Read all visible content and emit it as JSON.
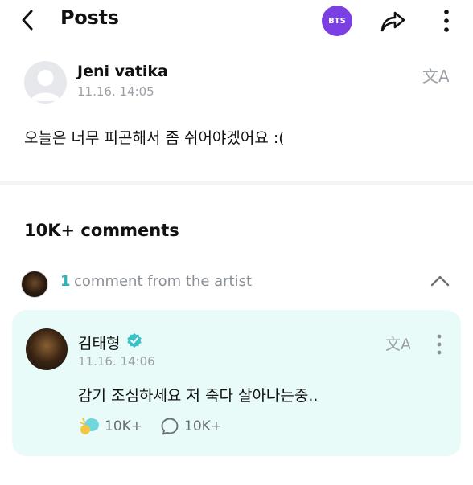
{
  "header": {
    "title": "Posts",
    "badge": "BTS"
  },
  "post": {
    "author": "Jeni vatika",
    "time": "11.16. 14:05",
    "body": "오늘은 너무 피곤해서 좀 쉬어야겠어요 :(",
    "translate_glyph": "文A"
  },
  "comments": {
    "count_label": "10K+ comments",
    "artist_filter": {
      "count": "1",
      "label": "comment from the artist"
    }
  },
  "artist_comment": {
    "name": "김태형",
    "time": "11.16. 14:06",
    "body": "감기 조심하세요 저 죽다 살아나는중..",
    "cheer_count": "10K+",
    "reply_count": "10K+",
    "translate_glyph": "文A"
  },
  "colors": {
    "badge": "#7b3fe4",
    "card": "#e8fbf8",
    "accent": "#2bb3b8",
    "verified": "#39c3c9"
  }
}
